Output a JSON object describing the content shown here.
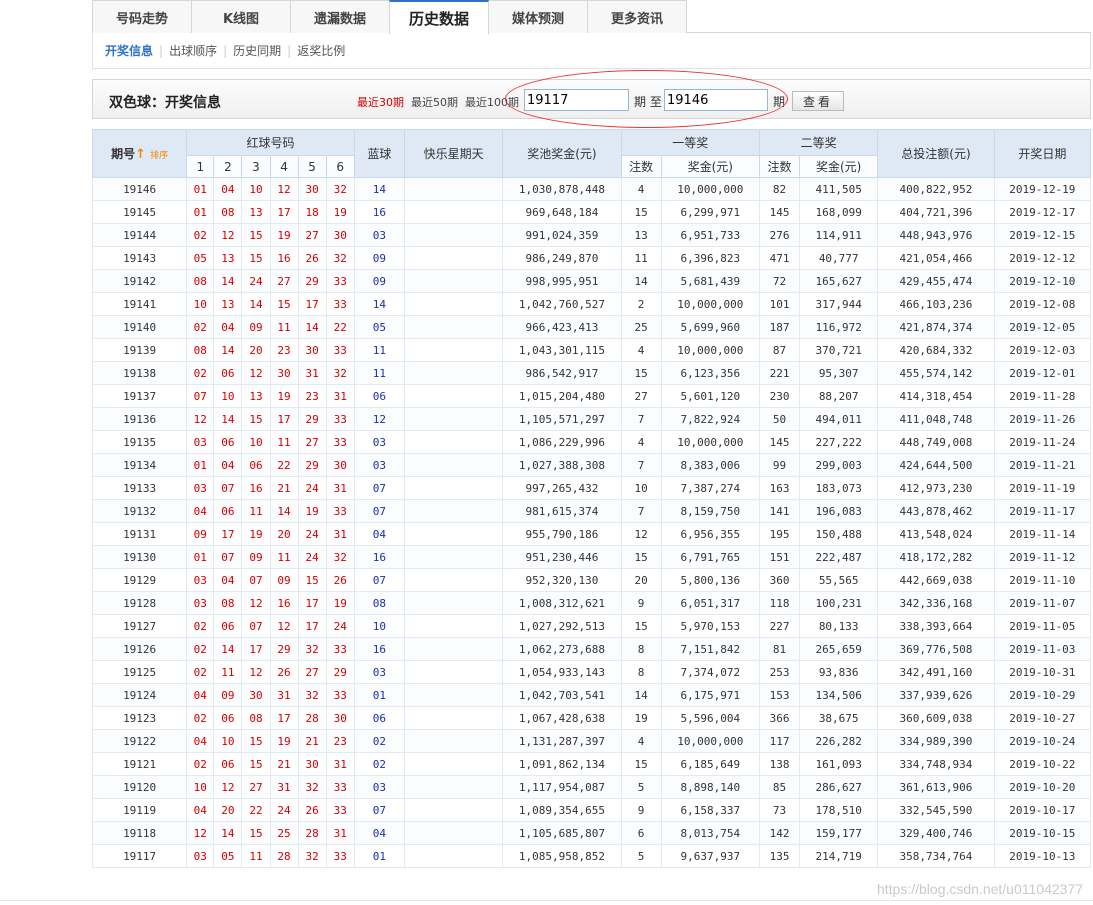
{
  "tabs": [
    "号码走势",
    "K线图",
    "遗漏数据",
    "历史数据",
    "媒体预测",
    "更多资讯"
  ],
  "subnav": [
    "开奖信息",
    "出球顺序",
    "历史同期",
    "返奖比例"
  ],
  "filter": {
    "title": "双色球：开奖信息",
    "quick_links": [
      "最近30期",
      "最近50期",
      "最近100期"
    ],
    "from_value": "19117",
    "to_label": "期 至",
    "to_value": "19146",
    "period_label": "期",
    "view_button": "查看"
  },
  "table": {
    "headers": {
      "issue": "期号",
      "sort": "排序",
      "red": "红球号码",
      "blue": "蓝球",
      "star": "快乐星期天",
      "pool": "奖池奖金(元)",
      "first": "一等奖",
      "second": "二等奖",
      "count": "注数",
      "prize": "奖金(元)",
      "total": "总投注额(元)",
      "date": "开奖日期",
      "red_cols": [
        "1",
        "2",
        "3",
        "4",
        "5",
        "6"
      ]
    },
    "rows": [
      [
        "19146",
        [
          "01",
          "04",
          "10",
          "12",
          "30",
          "32"
        ],
        "14",
        "",
        "1,030,878,448",
        "4",
        "10,000,000",
        "82",
        "411,505",
        "400,822,952",
        "2019-12-19"
      ],
      [
        "19145",
        [
          "01",
          "08",
          "13",
          "17",
          "18",
          "19"
        ],
        "16",
        "",
        "969,648,184",
        "15",
        "6,299,971",
        "145",
        "168,099",
        "404,721,396",
        "2019-12-17"
      ],
      [
        "19144",
        [
          "02",
          "12",
          "15",
          "19",
          "27",
          "30"
        ],
        "03",
        "",
        "991,024,359",
        "13",
        "6,951,733",
        "276",
        "114,911",
        "448,943,976",
        "2019-12-15"
      ],
      [
        "19143",
        [
          "05",
          "13",
          "15",
          "16",
          "26",
          "32"
        ],
        "09",
        "",
        "986,249,870",
        "11",
        "6,396,823",
        "471",
        "40,777",
        "421,054,466",
        "2019-12-12"
      ],
      [
        "19142",
        [
          "08",
          "14",
          "24",
          "27",
          "29",
          "33"
        ],
        "09",
        "",
        "998,995,951",
        "14",
        "5,681,439",
        "72",
        "165,627",
        "429,455,474",
        "2019-12-10"
      ],
      [
        "19141",
        [
          "10",
          "13",
          "14",
          "15",
          "17",
          "33"
        ],
        "14",
        "",
        "1,042,760,527",
        "2",
        "10,000,000",
        "101",
        "317,944",
        "466,103,236",
        "2019-12-08"
      ],
      [
        "19140",
        [
          "02",
          "04",
          "09",
          "11",
          "14",
          "22"
        ],
        "05",
        "",
        "966,423,413",
        "25",
        "5,699,960",
        "187",
        "116,972",
        "421,874,374",
        "2019-12-05"
      ],
      [
        "19139",
        [
          "08",
          "14",
          "20",
          "23",
          "30",
          "33"
        ],
        "11",
        "",
        "1,043,301,115",
        "4",
        "10,000,000",
        "87",
        "370,721",
        "420,684,332",
        "2019-12-03"
      ],
      [
        "19138",
        [
          "02",
          "06",
          "12",
          "30",
          "31",
          "32"
        ],
        "11",
        "",
        "986,542,917",
        "15",
        "6,123,356",
        "221",
        "95,307",
        "455,574,142",
        "2019-12-01"
      ],
      [
        "19137",
        [
          "07",
          "10",
          "13",
          "19",
          "23",
          "31"
        ],
        "06",
        "",
        "1,015,204,480",
        "27",
        "5,601,120",
        "230",
        "88,207",
        "414,318,454",
        "2019-11-28"
      ],
      [
        "19136",
        [
          "12",
          "14",
          "15",
          "17",
          "29",
          "33"
        ],
        "12",
        "",
        "1,105,571,297",
        "7",
        "7,822,924",
        "50",
        "494,011",
        "411,048,748",
        "2019-11-26"
      ],
      [
        "19135",
        [
          "03",
          "06",
          "10",
          "11",
          "27",
          "33"
        ],
        "03",
        "",
        "1,086,229,996",
        "4",
        "10,000,000",
        "145",
        "227,222",
        "448,749,008",
        "2019-11-24"
      ],
      [
        "19134",
        [
          "01",
          "04",
          "06",
          "22",
          "29",
          "30"
        ],
        "03",
        "",
        "1,027,388,308",
        "7",
        "8,383,006",
        "99",
        "299,003",
        "424,644,500",
        "2019-11-21"
      ],
      [
        "19133",
        [
          "03",
          "07",
          "16",
          "21",
          "24",
          "31"
        ],
        "07",
        "",
        "997,265,432",
        "10",
        "7,387,274",
        "163",
        "183,073",
        "412,973,230",
        "2019-11-19"
      ],
      [
        "19132",
        [
          "04",
          "06",
          "11",
          "14",
          "19",
          "33"
        ],
        "07",
        "",
        "981,615,374",
        "7",
        "8,159,750",
        "141",
        "196,083",
        "443,878,462",
        "2019-11-17"
      ],
      [
        "19131",
        [
          "09",
          "17",
          "19",
          "20",
          "24",
          "31"
        ],
        "04",
        "",
        "955,790,186",
        "12",
        "6,956,355",
        "195",
        "150,488",
        "413,548,024",
        "2019-11-14"
      ],
      [
        "19130",
        [
          "01",
          "07",
          "09",
          "11",
          "24",
          "32"
        ],
        "16",
        "",
        "951,230,446",
        "15",
        "6,791,765",
        "151",
        "222,487",
        "418,172,282",
        "2019-11-12"
      ],
      [
        "19129",
        [
          "03",
          "04",
          "07",
          "09",
          "15",
          "26"
        ],
        "07",
        "",
        "952,320,130",
        "20",
        "5,800,136",
        "360",
        "55,565",
        "442,669,038",
        "2019-11-10"
      ],
      [
        "19128",
        [
          "03",
          "08",
          "12",
          "16",
          "17",
          "19"
        ],
        "08",
        "",
        "1,008,312,621",
        "9",
        "6,051,317",
        "118",
        "100,231",
        "342,336,168",
        "2019-11-07"
      ],
      [
        "19127",
        [
          "02",
          "06",
          "07",
          "12",
          "17",
          "24"
        ],
        "10",
        "",
        "1,027,292,513",
        "15",
        "5,970,153",
        "227",
        "80,133",
        "338,393,664",
        "2019-11-05"
      ],
      [
        "19126",
        [
          "02",
          "14",
          "17",
          "29",
          "32",
          "33"
        ],
        "16",
        "",
        "1,062,273,688",
        "8",
        "7,151,842",
        "81",
        "265,659",
        "369,776,508",
        "2019-11-03"
      ],
      [
        "19125",
        [
          "02",
          "11",
          "12",
          "26",
          "27",
          "29"
        ],
        "03",
        "",
        "1,054,933,143",
        "8",
        "7,374,072",
        "253",
        "93,836",
        "342,491,160",
        "2019-10-31"
      ],
      [
        "19124",
        [
          "04",
          "09",
          "30",
          "31",
          "32",
          "33"
        ],
        "01",
        "",
        "1,042,703,541",
        "14",
        "6,175,971",
        "153",
        "134,506",
        "337,939,626",
        "2019-10-29"
      ],
      [
        "19123",
        [
          "02",
          "06",
          "08",
          "17",
          "28",
          "30"
        ],
        "06",
        "",
        "1,067,428,638",
        "19",
        "5,596,004",
        "366",
        "38,675",
        "360,609,038",
        "2019-10-27"
      ],
      [
        "19122",
        [
          "04",
          "10",
          "15",
          "19",
          "21",
          "23"
        ],
        "02",
        "",
        "1,131,287,397",
        "4",
        "10,000,000",
        "117",
        "226,282",
        "334,989,390",
        "2019-10-24"
      ],
      [
        "19121",
        [
          "02",
          "06",
          "15",
          "21",
          "30",
          "31"
        ],
        "02",
        "",
        "1,091,862,134",
        "15",
        "6,185,649",
        "138",
        "161,093",
        "334,748,934",
        "2019-10-22"
      ],
      [
        "19120",
        [
          "10",
          "12",
          "27",
          "31",
          "32",
          "33"
        ],
        "03",
        "",
        "1,117,954,087",
        "5",
        "8,898,140",
        "85",
        "286,627",
        "361,613,906",
        "2019-10-20"
      ],
      [
        "19119",
        [
          "04",
          "20",
          "22",
          "24",
          "26",
          "33"
        ],
        "07",
        "",
        "1,089,354,655",
        "9",
        "6,158,337",
        "73",
        "178,510",
        "332,545,590",
        "2019-10-17"
      ],
      [
        "19118",
        [
          "12",
          "14",
          "15",
          "25",
          "28",
          "31"
        ],
        "04",
        "",
        "1,105,685,807",
        "6",
        "8,013,754",
        "142",
        "159,177",
        "329,400,746",
        "2019-10-15"
      ],
      [
        "19117",
        [
          "03",
          "05",
          "11",
          "28",
          "32",
          "33"
        ],
        "01",
        "",
        "1,085,958,852",
        "5",
        "9,637,937",
        "135",
        "214,719",
        "358,734,764",
        "2019-10-13"
      ]
    ]
  },
  "watermark": "https://blog.csdn.net/u011042377",
  "colors": {
    "red": "#d40000",
    "blue": "#1a2fb5",
    "accent": "#2f73c9",
    "header_bg": "#dfe9f6"
  }
}
